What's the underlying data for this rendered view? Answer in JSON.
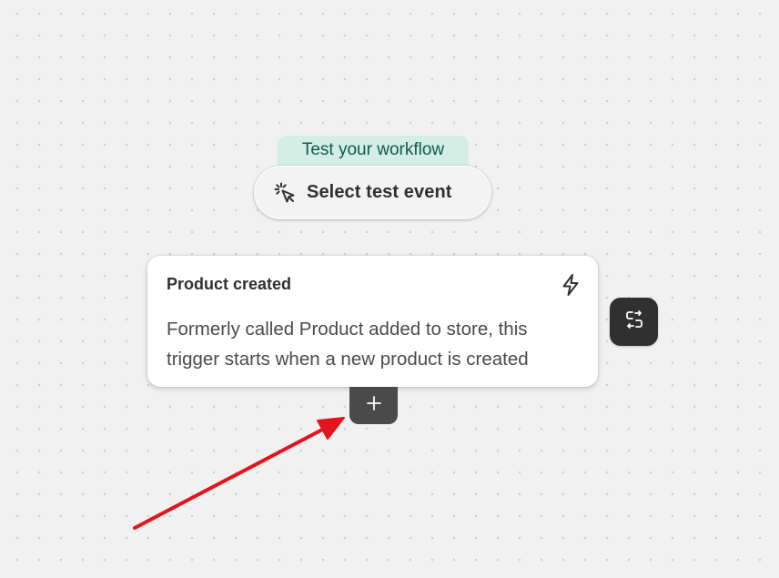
{
  "test_tag": {
    "label": "Test your workflow"
  },
  "select_event": {
    "label": "Select test event",
    "icon": "pointer-click-icon"
  },
  "trigger_card": {
    "title": "Product created",
    "description_line1": "Formerly called Product added to store, this",
    "description_line2": "trigger starts when a new product is created",
    "icon": "lightning-bolt-icon"
  },
  "swap_button": {
    "icon": "swap-icon"
  },
  "add_button": {
    "icon": "plus-icon"
  },
  "annotation": {
    "type": "arrow",
    "color": "#e5131b"
  },
  "colors": {
    "background": "#f1f1f1",
    "tag_background": "#d4ede5",
    "tag_text": "#0d5c4d",
    "dark_button": "#303030",
    "add_button": "#4a4a4a"
  }
}
